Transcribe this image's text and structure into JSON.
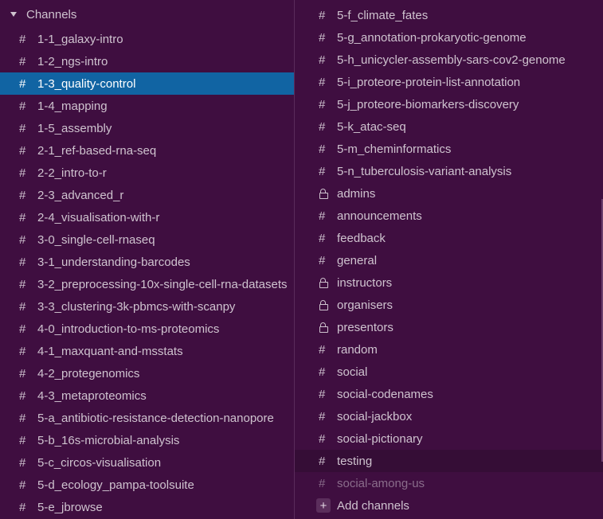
{
  "left": {
    "section_label": "Channels",
    "channels": [
      {
        "name": "1-1_galaxy-intro",
        "kind": "public",
        "state": "normal"
      },
      {
        "name": "1-2_ngs-intro",
        "kind": "public",
        "state": "normal"
      },
      {
        "name": "1-3_quality-control",
        "kind": "public",
        "state": "active"
      },
      {
        "name": "1-4_mapping",
        "kind": "public",
        "state": "normal"
      },
      {
        "name": "1-5_assembly",
        "kind": "public",
        "state": "normal"
      },
      {
        "name": "2-1_ref-based-rna-seq",
        "kind": "public",
        "state": "normal"
      },
      {
        "name": "2-2_intro-to-r",
        "kind": "public",
        "state": "normal"
      },
      {
        "name": "2-3_advanced_r",
        "kind": "public",
        "state": "normal"
      },
      {
        "name": "2-4_visualisation-with-r",
        "kind": "public",
        "state": "normal"
      },
      {
        "name": "3-0_single-cell-rnaseq",
        "kind": "public",
        "state": "normal"
      },
      {
        "name": "3-1_understanding-barcodes",
        "kind": "public",
        "state": "normal"
      },
      {
        "name": "3-2_preprocessing-10x-single-cell-rna-datasets",
        "kind": "public",
        "state": "normal"
      },
      {
        "name": "3-3_clustering-3k-pbmcs-with-scanpy",
        "kind": "public",
        "state": "normal"
      },
      {
        "name": "4-0_introduction-to-ms-proteomics",
        "kind": "public",
        "state": "normal"
      },
      {
        "name": "4-1_maxquant-and-msstats",
        "kind": "public",
        "state": "normal"
      },
      {
        "name": "4-2_protegenomics",
        "kind": "public",
        "state": "normal"
      },
      {
        "name": "4-3_metaproteomics",
        "kind": "public",
        "state": "normal"
      },
      {
        "name": "5-a_antibiotic-resistance-detection-nanopore",
        "kind": "public",
        "state": "normal"
      },
      {
        "name": "5-b_16s-microbial-analysis",
        "kind": "public",
        "state": "normal"
      },
      {
        "name": "5-c_circos-visualisation",
        "kind": "public",
        "state": "normal"
      },
      {
        "name": "5-d_ecology_pampa-toolsuite",
        "kind": "public",
        "state": "normal"
      },
      {
        "name": "5-e_jbrowse",
        "kind": "public",
        "state": "normal"
      }
    ]
  },
  "right": {
    "channels": [
      {
        "name": "5-f_climate_fates",
        "kind": "public",
        "state": "normal"
      },
      {
        "name": "5-g_annotation-prokaryotic-genome",
        "kind": "public",
        "state": "normal"
      },
      {
        "name": "5-h_unicycler-assembly-sars-cov2-genome",
        "kind": "public",
        "state": "normal"
      },
      {
        "name": "5-i_proteore-protein-list-annotation",
        "kind": "public",
        "state": "normal"
      },
      {
        "name": "5-j_proteore-biomarkers-discovery",
        "kind": "public",
        "state": "normal"
      },
      {
        "name": "5-k_atac-seq",
        "kind": "public",
        "state": "normal"
      },
      {
        "name": "5-m_cheminformatics",
        "kind": "public",
        "state": "normal"
      },
      {
        "name": "5-n_tuberculosis-variant-analysis",
        "kind": "public",
        "state": "normal"
      },
      {
        "name": "admins",
        "kind": "private",
        "state": "normal"
      },
      {
        "name": "announcements",
        "kind": "public",
        "state": "normal"
      },
      {
        "name": "feedback",
        "kind": "public",
        "state": "normal"
      },
      {
        "name": "general",
        "kind": "public",
        "state": "normal"
      },
      {
        "name": "instructors",
        "kind": "private",
        "state": "normal"
      },
      {
        "name": "organisers",
        "kind": "private",
        "state": "normal"
      },
      {
        "name": "presentors",
        "kind": "private",
        "state": "normal"
      },
      {
        "name": "random",
        "kind": "public",
        "state": "normal"
      },
      {
        "name": "social",
        "kind": "public",
        "state": "normal"
      },
      {
        "name": "social-codenames",
        "kind": "public",
        "state": "normal"
      },
      {
        "name": "social-jackbox",
        "kind": "public",
        "state": "normal"
      },
      {
        "name": "social-pictionary",
        "kind": "public",
        "state": "normal"
      },
      {
        "name": "testing",
        "kind": "public",
        "state": "hover"
      },
      {
        "name": "social-among-us",
        "kind": "public",
        "state": "muted"
      }
    ],
    "add_channels_label": "Add channels",
    "add_symbol": "+"
  },
  "symbols": {
    "public": "#"
  },
  "colors": {
    "sidebar_bg": "#3f0e40",
    "active_bg": "#1164a3",
    "text": "#cfc3cf",
    "muted_text": "#8a6d8b",
    "hover_bg": "#350d36"
  }
}
